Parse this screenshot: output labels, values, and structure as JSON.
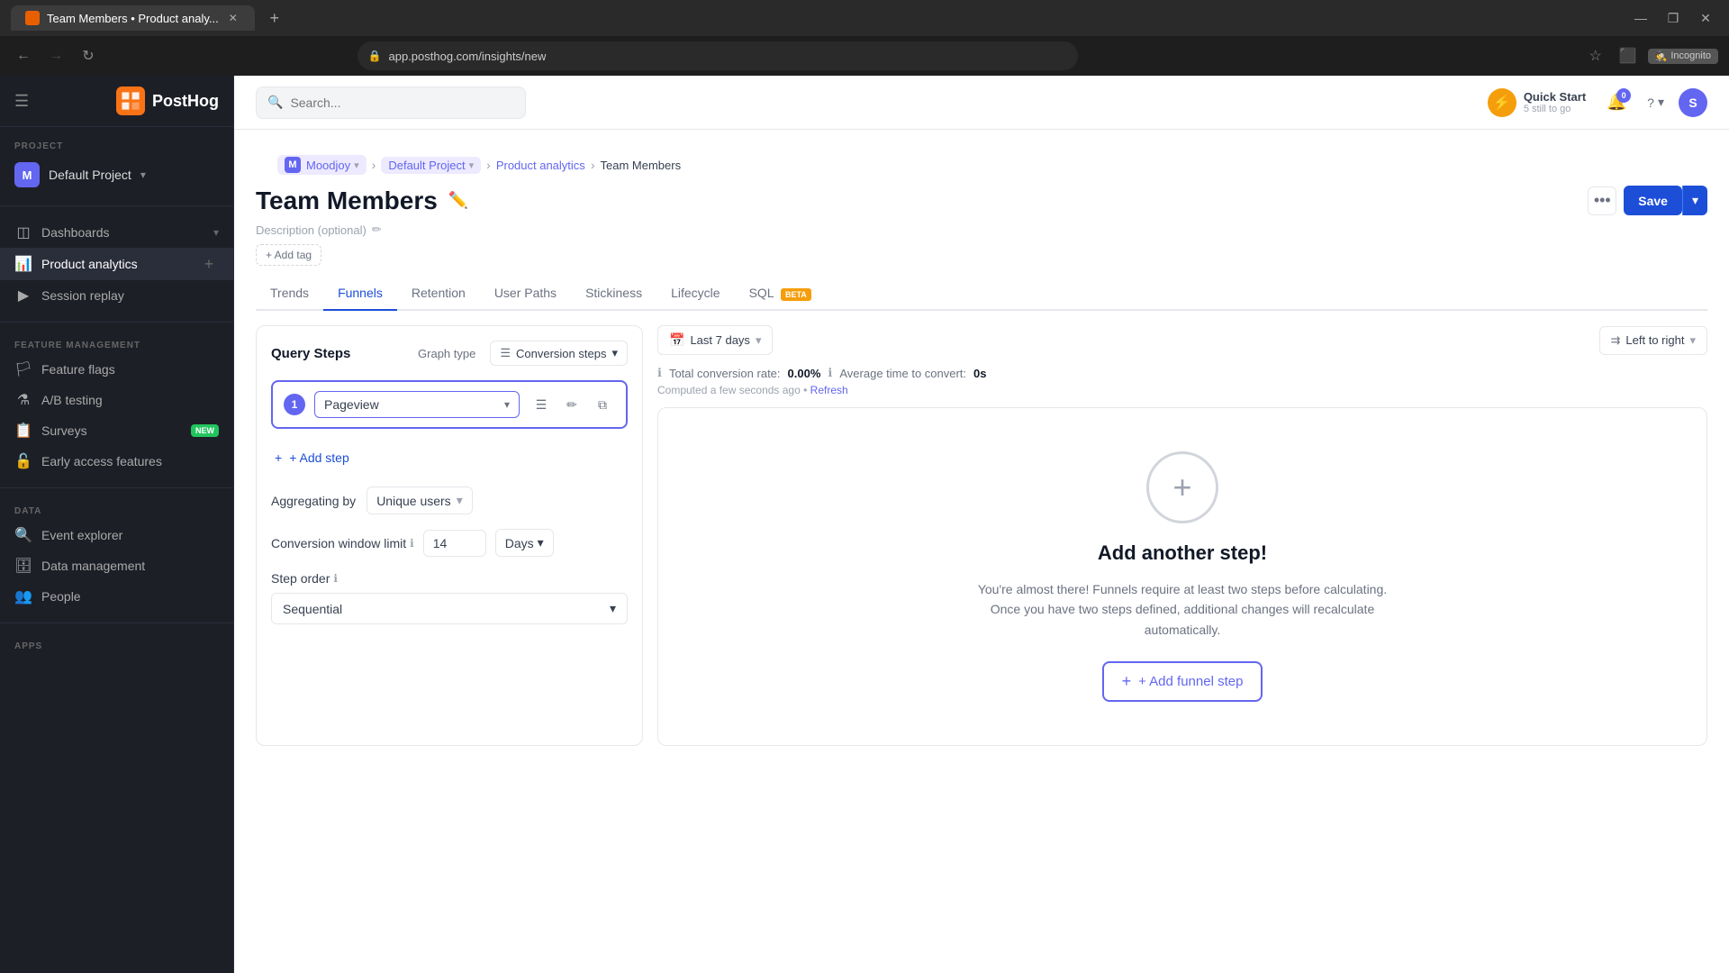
{
  "browser": {
    "tab_title": "Team Members • Product analy...",
    "url": "app.posthog.com/insights/new",
    "new_tab_label": "+",
    "incognito_label": "Incognito",
    "notif_count": "0",
    "user_initial": "S"
  },
  "topbar": {
    "search_placeholder": "Search...",
    "quick_start_label": "Quick Start",
    "quick_start_sub": "5 still to go",
    "notif_count": "0",
    "help_label": "?",
    "user_initial": "S"
  },
  "sidebar": {
    "logo": "PostHog",
    "project_label": "PROJECT",
    "project_initial": "M",
    "project_name": "Default Project",
    "nav_items": [
      {
        "id": "dashboards",
        "label": "Dashboards",
        "icon": "◫",
        "has_expand": true
      },
      {
        "id": "product-analytics",
        "label": "Product analytics",
        "icon": "📊",
        "has_plus": true,
        "active": true
      },
      {
        "id": "session-replay",
        "label": "Session replay",
        "icon": "▶"
      }
    ],
    "feature_management_label": "FEATURE MANAGEMENT",
    "feature_nav": [
      {
        "id": "feature-flags",
        "label": "Feature flags",
        "icon": "🏳"
      },
      {
        "id": "ab-testing",
        "label": "A/B testing",
        "icon": "⚗"
      },
      {
        "id": "surveys",
        "label": "Surveys",
        "icon": "📋",
        "badge": "NEW"
      },
      {
        "id": "early-access",
        "label": "Early access features",
        "icon": "🔓"
      }
    ],
    "data_label": "DATA",
    "data_nav": [
      {
        "id": "event-explorer",
        "label": "Event explorer",
        "icon": "🔍"
      },
      {
        "id": "data-management",
        "label": "Data management",
        "icon": "🗄"
      },
      {
        "id": "people",
        "label": "People",
        "icon": "👥"
      }
    ],
    "apps_label": "APPS"
  },
  "breadcrumb": {
    "project_initial": "M",
    "project_name": "Moodjoy",
    "default_project": "Default Project",
    "section": "Product analytics",
    "current": "Team Members"
  },
  "page": {
    "title": "Team Members",
    "description": "Description (optional)",
    "add_tag": "+ Add tag",
    "tabs": [
      {
        "id": "trends",
        "label": "Trends"
      },
      {
        "id": "funnels",
        "label": "Funnels",
        "active": true
      },
      {
        "id": "retention",
        "label": "Retention"
      },
      {
        "id": "user-paths",
        "label": "User Paths"
      },
      {
        "id": "stickiness",
        "label": "Stickiness"
      },
      {
        "id": "lifecycle",
        "label": "Lifecycle"
      },
      {
        "id": "sql",
        "label": "SQL",
        "badge": "BETA"
      }
    ]
  },
  "query": {
    "label": "Query Steps",
    "graph_type_label": "Graph type",
    "conversion_steps": "Conversion steps",
    "step_number": "1",
    "step_value": "Pageview",
    "add_step": "+ Add step",
    "aggregating_label": "Aggregating by",
    "aggregating_value": "Unique users",
    "conv_window_label": "Conversion window limit",
    "conv_window_value": "14",
    "conv_window_unit": "Days",
    "step_order_label": "Step order",
    "step_order_value": "Sequential"
  },
  "results": {
    "date_range": "Last 7 days",
    "direction": "Left to right",
    "conversion_rate_label": "Total conversion rate:",
    "conversion_rate_value": "0.00%",
    "avg_time_label": "Average time to convert:",
    "avg_time_value": "0s",
    "computed_text": "Computed a few seconds ago",
    "refresh": "Refresh",
    "empty_title": "Add another step!",
    "empty_desc": "You're almost there! Funnels require at least two steps before calculating. Once you have two steps defined, additional changes will recalculate automatically.",
    "add_funnel_step": "+ Add funnel step"
  }
}
